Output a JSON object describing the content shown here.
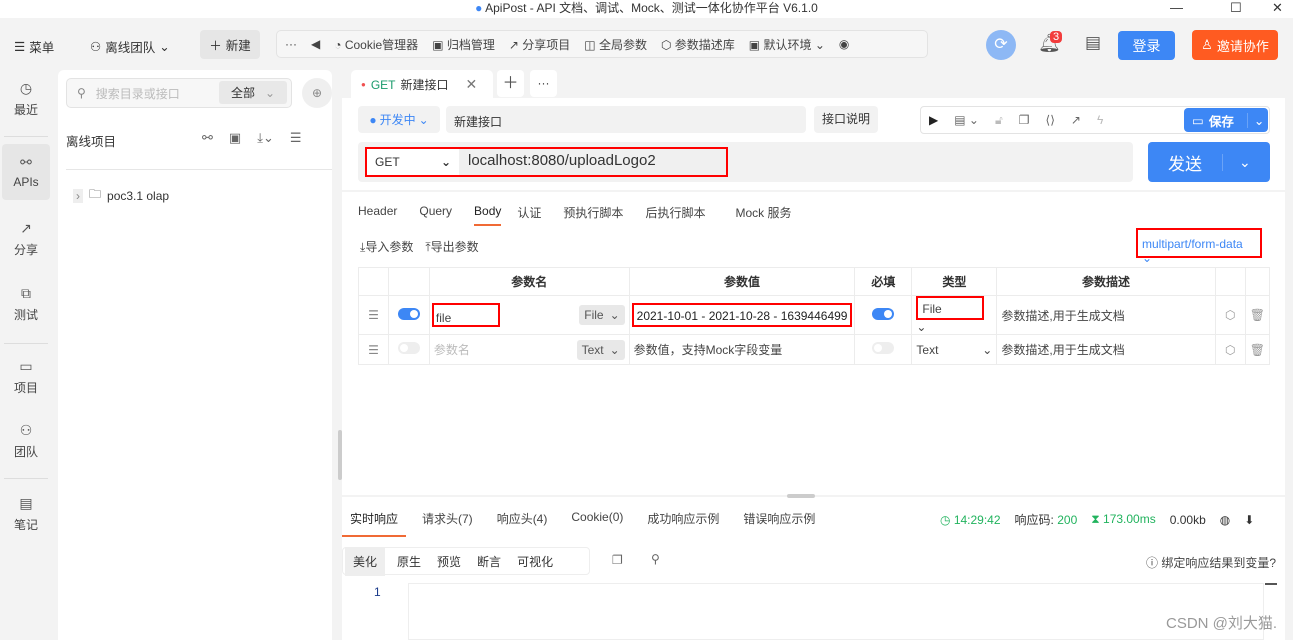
{
  "window": {
    "title": "ApiPost - API 文档、调试、Mock、测试一体化协作平台 V6.1.0"
  },
  "topbar": {
    "menu": "菜单",
    "team": "离线团队",
    "new": "新建",
    "toolbar": [
      "Cookie管理器",
      "归档管理",
      "分享项目",
      "全局参数",
      "参数描述库",
      "默认环境"
    ],
    "notifications": "3",
    "login": "登录",
    "invite": "邀请协作"
  },
  "rail": [
    {
      "label": "最近",
      "icon": "clock-icon"
    },
    {
      "label": "APIs",
      "icon": "link-icon",
      "active": true
    },
    {
      "label": "分享",
      "icon": "share-icon"
    },
    {
      "label": "测试",
      "icon": "flow-icon"
    },
    {
      "label": "项目",
      "icon": "project-icon"
    },
    {
      "label": "团队",
      "icon": "team-icon"
    },
    {
      "label": "笔记",
      "icon": "note-icon"
    }
  ],
  "sidebar": {
    "search_placeholder": "搜索目录或接口",
    "filter": "全部",
    "section": "离线项目",
    "tree": [
      {
        "label": "poc3.1 olap"
      }
    ]
  },
  "tabs": [
    {
      "method": "GET",
      "label": "新建接口"
    }
  ],
  "request": {
    "status": "开发中",
    "name": "新建接口",
    "doc_button": "接口说明",
    "save": "保存",
    "method": "GET",
    "url": "localhost:8080/uploadLogo2",
    "send": "发送"
  },
  "req_tabs": [
    "Header",
    "Query",
    "Body",
    "认证",
    "预执行脚本",
    "后执行脚本",
    "Mock 服务"
  ],
  "req_tab_active": "Body",
  "body": {
    "import": "导入参数",
    "export": "导出参数",
    "content_type": "multipart/form-data",
    "columns": [
      "参数名",
      "参数值",
      "必填",
      "类型",
      "参数描述"
    ],
    "rows": [
      {
        "name": "file",
        "name_ph": "参数名",
        "field_type": "File",
        "value": "2021-10-01 - 2021-10-28 - 1639446499",
        "required": true,
        "type": "File",
        "desc_ph": "参数描述,用于生成文档"
      },
      {
        "name": "",
        "name_ph": "参数名",
        "field_type": "Text",
        "value": "",
        "value_ph": "参数值，支持Mock字段变量",
        "required": false,
        "type": "Text",
        "desc_ph": "参数描述,用于生成文档"
      }
    ]
  },
  "response": {
    "tabs": [
      "实时响应",
      "请求头(7)",
      "响应头(4)",
      "Cookie(0)",
      "成功响应示例",
      "错误响应示例"
    ],
    "time": "14:29:42",
    "code_label": "响应码:",
    "code": "200",
    "duration": "173.00ms",
    "size": "0.00kb",
    "view_tabs": [
      "美化",
      "原生",
      "预览",
      "断言",
      "可视化"
    ],
    "bind": "绑定响应结果到变量?",
    "line": "1"
  },
  "watermark": "CSDN @刘大猫."
}
